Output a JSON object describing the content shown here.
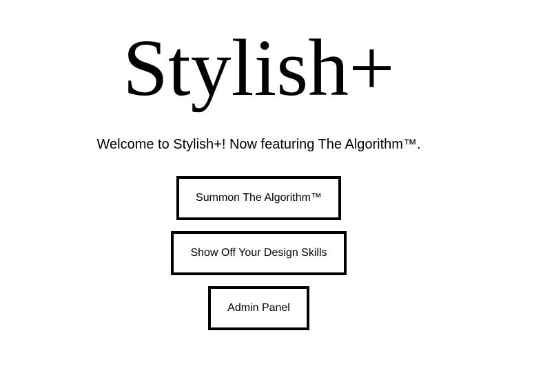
{
  "header": {
    "logo_text": "Stylish+",
    "tagline": "Welcome to Stylish+! Now featuring The Algorithm™."
  },
  "menu": {
    "buttons": [
      {
        "label": "Summon The Algorithm™"
      },
      {
        "label": "Show Off Your Design Skills"
      },
      {
        "label": "Admin Panel"
      }
    ]
  },
  "colors": {
    "background": "#ffffff",
    "text": "#000000",
    "border": "#000000"
  }
}
